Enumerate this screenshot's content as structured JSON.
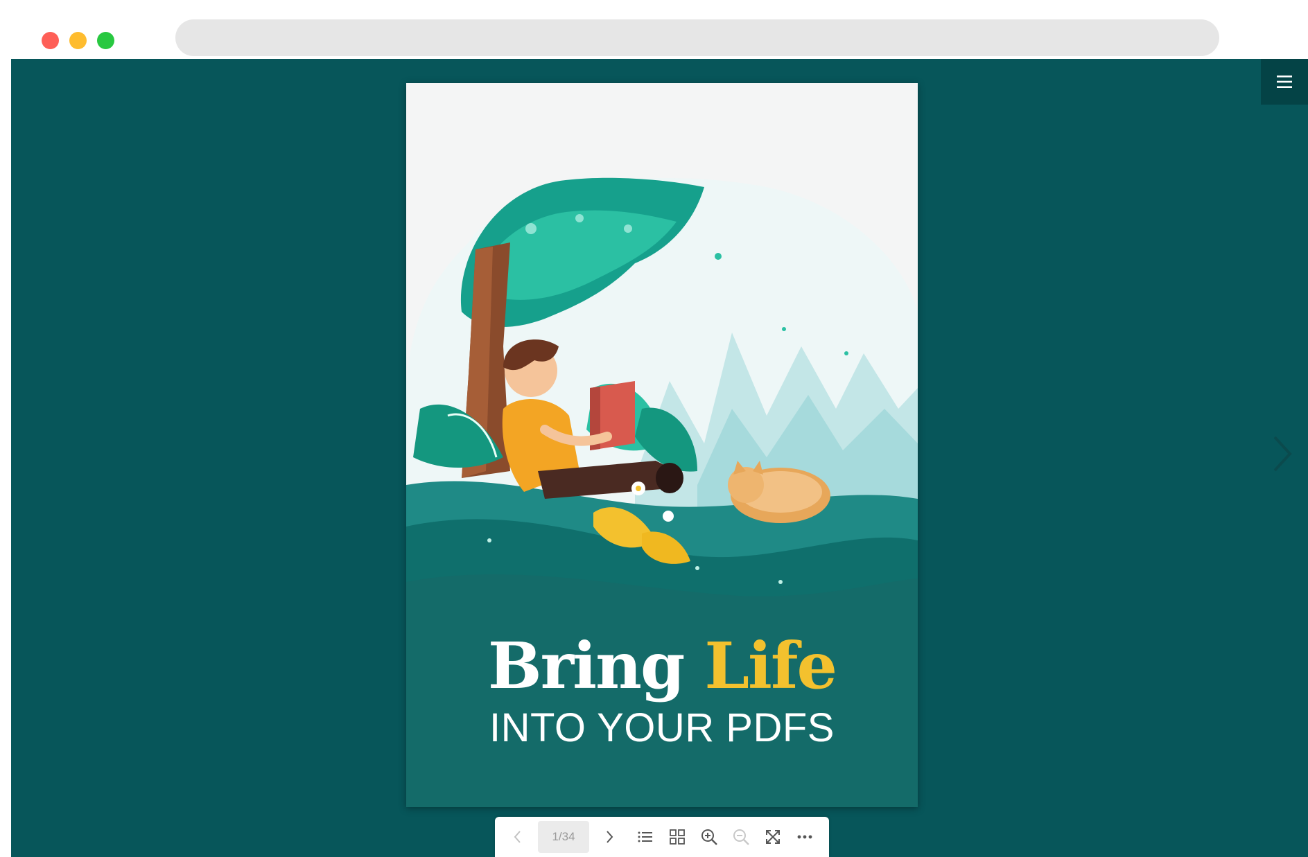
{
  "browser": {
    "controls": [
      "close",
      "minimize",
      "maximize"
    ],
    "address": ""
  },
  "viewer": {
    "background": "#07565a",
    "menu_icon": "hamburger-menu-icon",
    "next_icon": "chevron-right-icon"
  },
  "cover": {
    "title_word_1": "Bring",
    "title_word_2": "Life",
    "subtitle": "INTO YOUR PDFS",
    "title_color": "#ffffff",
    "accent_color": "#f3c12e"
  },
  "toolbar": {
    "page_indicator": "1/34",
    "buttons": [
      {
        "name": "previous-page",
        "icon": "chevron-left-icon"
      },
      {
        "name": "next-page",
        "icon": "chevron-right-icon"
      },
      {
        "name": "table-of-contents",
        "icon": "list-icon"
      },
      {
        "name": "thumbnails",
        "icon": "grid-icon"
      },
      {
        "name": "zoom-in",
        "icon": "zoom-in-icon"
      },
      {
        "name": "zoom-out",
        "icon": "zoom-out-icon"
      },
      {
        "name": "fullscreen",
        "icon": "fullscreen-icon"
      },
      {
        "name": "more",
        "icon": "more-icon"
      }
    ]
  }
}
